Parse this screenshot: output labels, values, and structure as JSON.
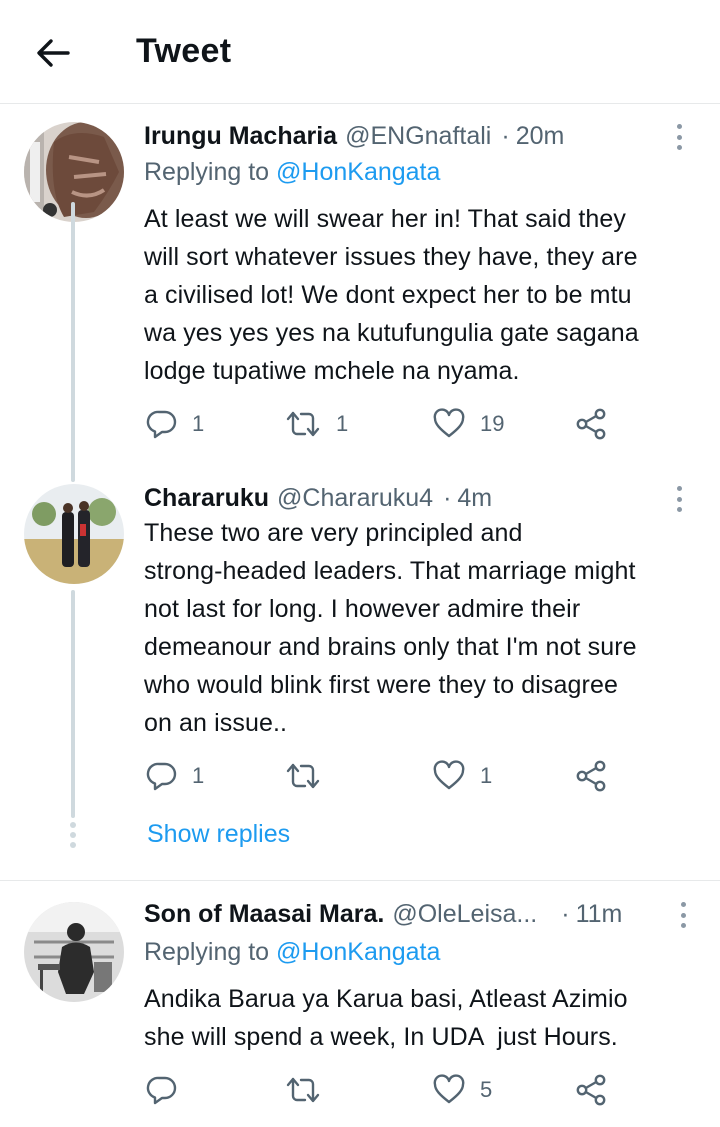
{
  "header": {
    "title": "Tweet",
    "back_icon": "arrow-left-icon"
  },
  "tweets": [
    {
      "name": "Irungu Macharia",
      "handle": "@ENGnaftali",
      "sep": "·",
      "time": "20m",
      "reply_prefix": "Replying to",
      "reply_handle": "@HonKangata",
      "body_lines": [
        "At least we will swear her in! That said they",
        "will sort whatever issues they have, they are",
        "a civilised lot! We dont expect her to be mtu",
        "wa yes yes yes na kutufungulia gate sagana",
        "lodge tupatiwe mchele na nyama."
      ],
      "replies": "1",
      "retweets": "1",
      "likes": "19"
    },
    {
      "name": "Chararuku",
      "handle": "@Chararuku4",
      "sep": "·",
      "time": "4m",
      "body_lines": [
        "These two are very principled and",
        "strong-headed leaders. That marriage might",
        "not last for long. I however admire their",
        "demeanour and brains only that I'm not sure",
        "who would blink first were they to disagree",
        "on an issue.."
      ],
      "replies": "1",
      "retweets": "",
      "likes": "1"
    },
    {
      "name": "Son of Maasai Mara.",
      "handle": "@OleLeisa...",
      "sep": "·",
      "time": "11m",
      "reply_prefix": "Replying to",
      "reply_handle": "@HonKangata",
      "body_lines": [
        "Andika Barua ya Karua basi, Atleast Azimio",
        "she will spend a week, In UDA  just Hours."
      ],
      "replies": "",
      "retweets": "",
      "likes": "5"
    }
  ],
  "show_replies": "Show replies",
  "colors": {
    "accent": "#1d9bf0",
    "secondary_text": "#536471",
    "primary_text": "#0f1419",
    "divider": "#e7e9ea"
  },
  "icons": [
    "reply-icon",
    "retweet-icon",
    "like-icon",
    "share-icon",
    "more-options-icon"
  ]
}
